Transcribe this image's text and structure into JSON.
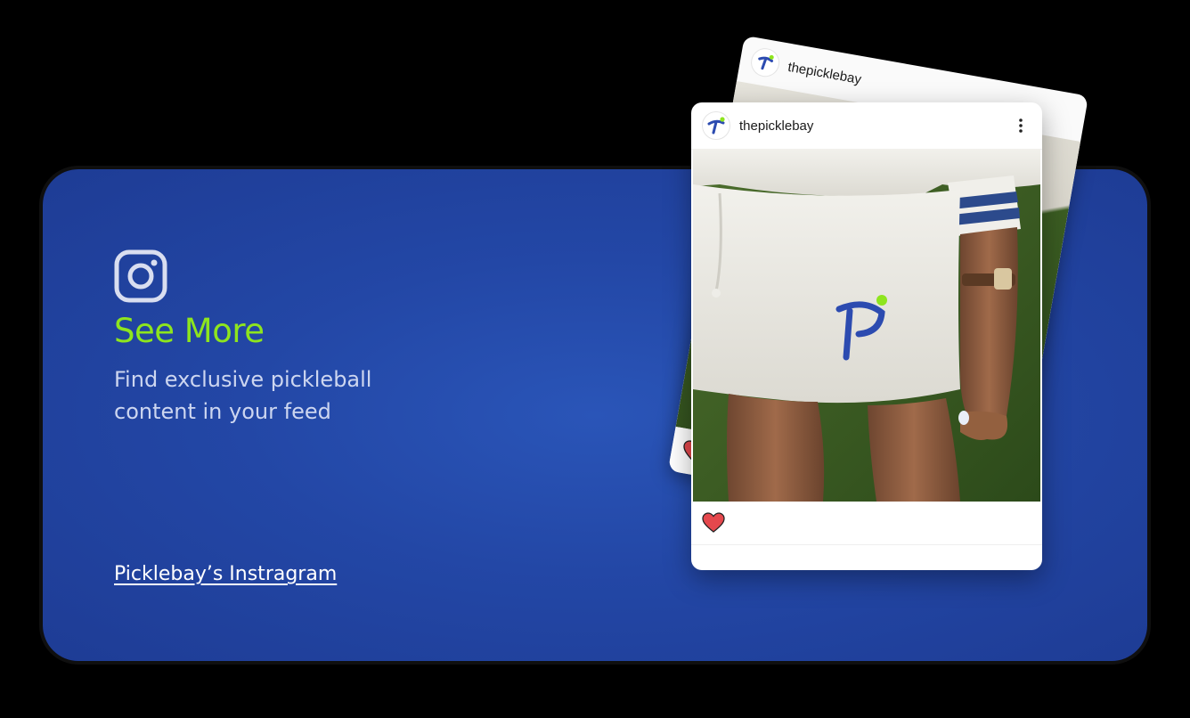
{
  "promo": {
    "title": "See More",
    "subtitle": "Find exclusive pickleball content in your feed",
    "link_label": "Picklebay’s Instragram"
  },
  "posts": {
    "back": {
      "username": "thepicklebay"
    },
    "front": {
      "username": "thepicklebay"
    }
  },
  "icons": {
    "instagram": "instagram-icon",
    "more": "more-vertical-icon",
    "like": "heart-icon",
    "avatar": "picklebay-logo"
  },
  "colors": {
    "accent": "#8ee51e",
    "card_bg": "#2347a6",
    "subtitle": "#cdd6f0",
    "heart": "#e5484d",
    "brand_blue": "#2c4bb0"
  }
}
